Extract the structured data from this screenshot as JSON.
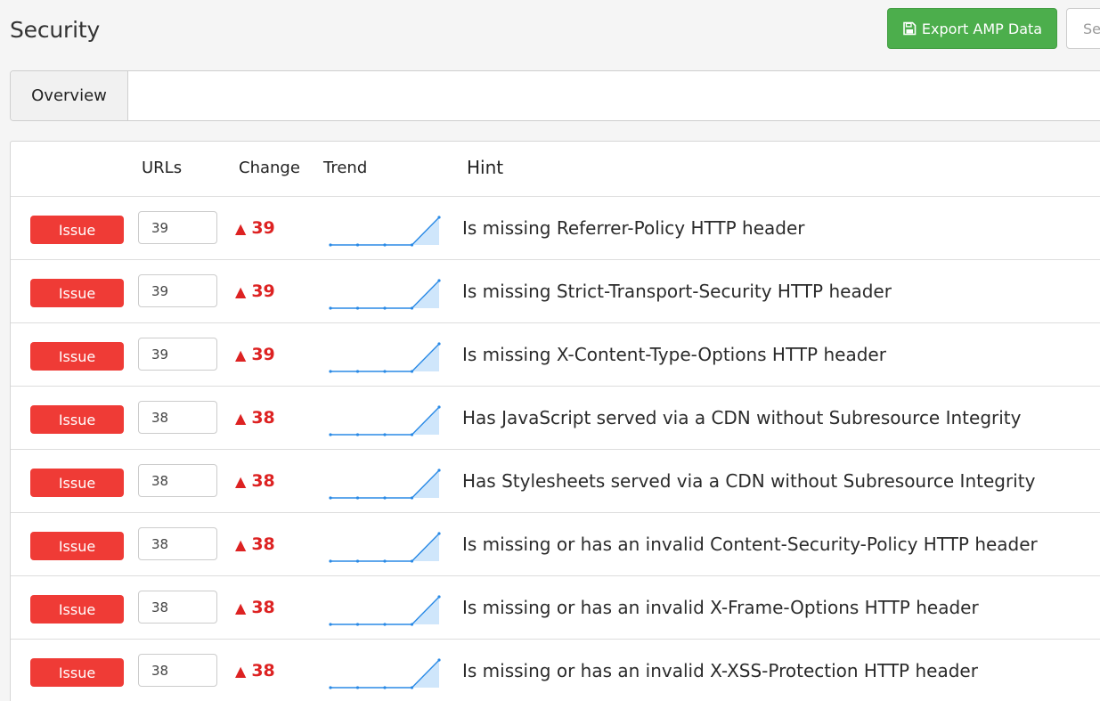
{
  "header": {
    "title": "Security",
    "export_label": "Export AMP Data",
    "search_placeholder": "Search"
  },
  "tabs": [
    {
      "label": "Overview"
    }
  ],
  "table": {
    "headers": {
      "urls": "URLs",
      "change": "Change",
      "trend": "Trend",
      "hint": "Hint"
    },
    "rows": [
      {
        "badge": "Issue",
        "urls": "39",
        "change": "39",
        "trend": [
          0,
          0,
          0,
          0,
          39
        ],
        "hint": "Is missing Referrer-Policy HTTP header"
      },
      {
        "badge": "Issue",
        "urls": "39",
        "change": "39",
        "trend": [
          0,
          0,
          0,
          0,
          39
        ],
        "hint": "Is missing Strict-Transport-Security HTTP header"
      },
      {
        "badge": "Issue",
        "urls": "39",
        "change": "39",
        "trend": [
          0,
          0,
          0,
          0,
          39
        ],
        "hint": "Is missing X-Content-Type-Options HTTP header"
      },
      {
        "badge": "Issue",
        "urls": "38",
        "change": "38",
        "trend": [
          0,
          0,
          0,
          0,
          38
        ],
        "hint": "Has JavaScript served via a CDN without Subresource Integrity"
      },
      {
        "badge": "Issue",
        "urls": "38",
        "change": "38",
        "trend": [
          0,
          0,
          0,
          0,
          38
        ],
        "hint": "Has Stylesheets served via a CDN without Subresource Integrity"
      },
      {
        "badge": "Issue",
        "urls": "38",
        "change": "38",
        "trend": [
          0,
          0,
          0,
          0,
          38
        ],
        "hint": "Is missing or has an invalid Content-Security-Policy HTTP header"
      },
      {
        "badge": "Issue",
        "urls": "38",
        "change": "38",
        "trend": [
          0,
          0,
          0,
          0,
          38
        ],
        "hint": "Is missing or has an invalid X-Frame-Options HTTP header"
      },
      {
        "badge": "Issue",
        "urls": "38",
        "change": "38",
        "trend": [
          0,
          0,
          0,
          0,
          38
        ],
        "hint": "Is missing or has an invalid X-XSS-Protection HTTP header"
      }
    ]
  },
  "colors": {
    "export_button": "#4cae4c",
    "issue_badge": "#ef3b36",
    "change_up": "#dd2222",
    "trend_line": "#2a8ae6",
    "trend_fill": "#cfe6fb"
  },
  "icons": {
    "export": "floppy-disk-icon",
    "change_up": "triangle-up-icon"
  }
}
